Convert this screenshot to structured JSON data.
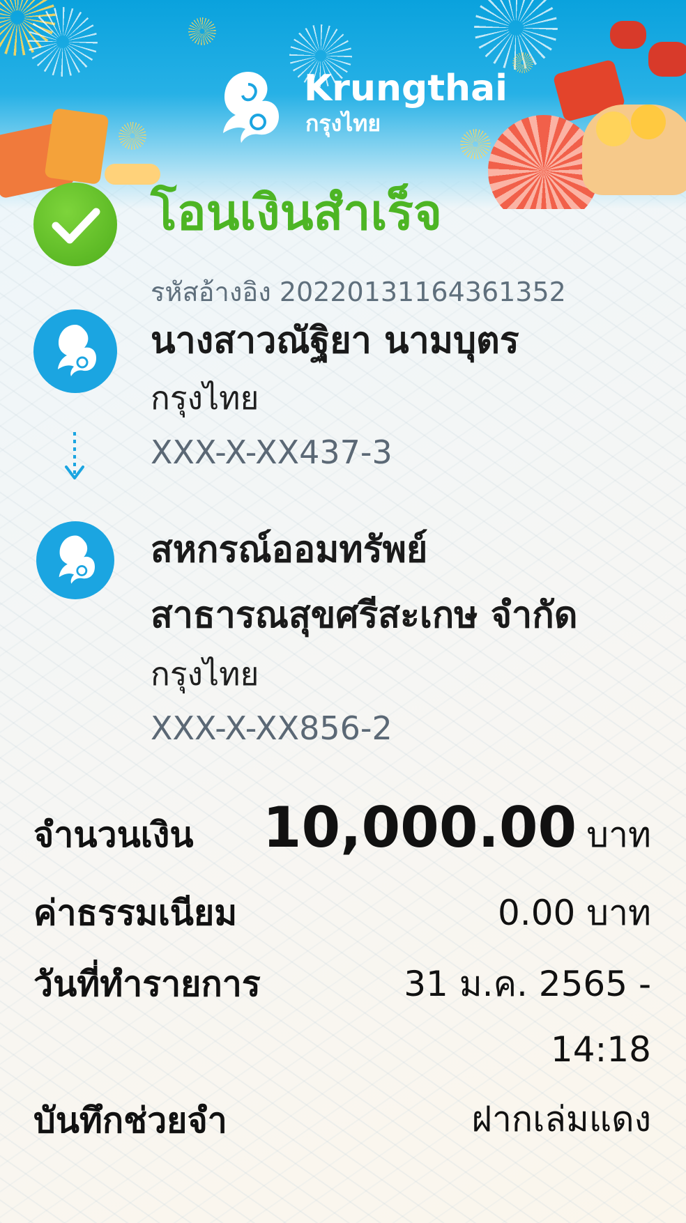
{
  "header": {
    "brand_en": "Krungthai",
    "brand_th": "กรุงไทย",
    "logo_icon": "krungthai-bird-logo-icon",
    "colors": {
      "sky": "#0aa2dd",
      "gold": "#ffd65a",
      "red": "#e3442b"
    }
  },
  "status": {
    "title": "โอนเงินสำเร็จ",
    "reference": "รหัสอ้างอิง 2022013116436135​2",
    "icon": "check-icon",
    "color": "#4db524"
  },
  "sender": {
    "name": "นางสาวณัฐิยา นามบุตร",
    "bank": "กรุงไทย",
    "account": "XXX-X-XX437-3"
  },
  "receiver": {
    "name_line1": "สหกรณ์ออมทรัพย์",
    "name_line2": "สาธารณสุขศรีสะเกษ จำกัด",
    "bank": "กรุงไทย",
    "account": "XXX-X-XX856-2"
  },
  "details": {
    "amount_label": "จำนวนเงิน",
    "amount_value": "10,000.00",
    "amount_unit": "บาท",
    "fee_label": "ค่าธรรมเนียม",
    "fee_value": "0.00 บาท",
    "date_label": "วันที่ทำรายการ",
    "date_value_line1": "31 ม.ค. 2565 -",
    "date_value_line2": "14:18",
    "memo_label": "บันทึกช่วยจำ",
    "memo_value": "ฝากเล่มแดง"
  }
}
